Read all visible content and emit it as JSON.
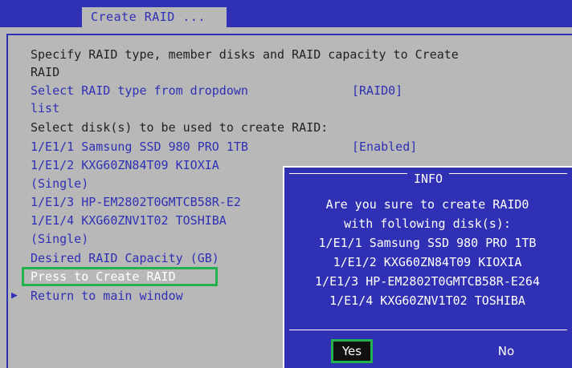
{
  "header": {
    "title": "Create RAID ..."
  },
  "form": {
    "description_line1": "Specify RAID type, member disks and RAID capacity to Create",
    "description_line2": "RAID",
    "raid_type_label_line1": "Select RAID type from dropdown",
    "raid_type_label_line2": "list",
    "raid_type_value": "[RAID0]",
    "disk_select_label": "Select disk(s) to be used to create RAID:",
    "disks": [
      {
        "line1": "1/E1/1 Samsung SSD 980 PRO 1TB",
        "line2": "",
        "value": "[Enabled]"
      },
      {
        "line1": "1/E1/2 KXG60ZN84T09 KIOXIA",
        "line2": "(Single)",
        "value": ""
      },
      {
        "line1": "1/E1/3 HP-EM2802T0GMTCB58R-E2",
        "line2": "",
        "value": ""
      },
      {
        "line1": "1/E1/4 KXG60ZNV1T02 TOSHIBA",
        "line2": "(Single)",
        "value": ""
      }
    ],
    "capacity_label": "Desired RAID Capacity (GB)",
    "create_action": "Press to Create RAID",
    "return_action": "Return to main window",
    "arrow": "▶"
  },
  "dialog": {
    "title": "INFO",
    "message_line1": "Are you sure to create RAID0",
    "message_line2": "with following disk(s):",
    "disks": [
      "1/E1/1 Samsung SSD 980 PRO 1TB",
      "1/E1/2 KXG60ZN84T09 KIOXIA",
      "1/E1/3 HP-EM2802T0GMTCB58R-E264",
      "1/E1/4 KXG60ZNV1T02 TOSHIBA"
    ],
    "yes_label": "Yes",
    "no_label": "No"
  },
  "colors": {
    "background": "#b8b8b8",
    "accent": "#2f30b4",
    "highlight_border": "#22b14c"
  }
}
